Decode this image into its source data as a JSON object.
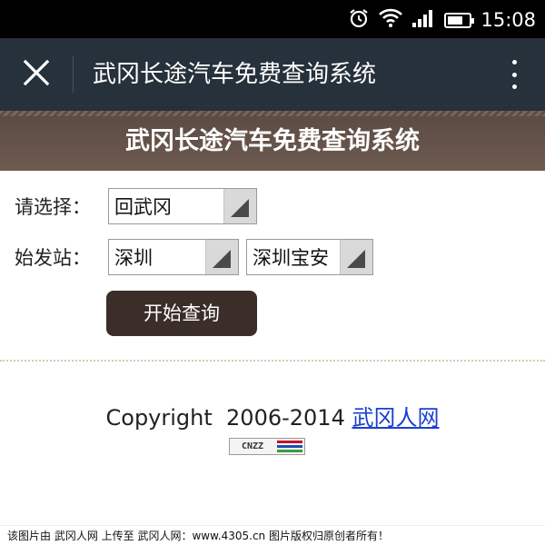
{
  "status_bar": {
    "time": "15:08",
    "icons": [
      "alarm-icon",
      "wifi-icon",
      "signal-icon",
      "battery-icon"
    ],
    "battery_level_pct": 70
  },
  "app_bar": {
    "title": "武冈长途汽车免费查询系统",
    "close_icon": "close-icon",
    "more_icon": "more-vertical-icon"
  },
  "header": {
    "title": "武冈长途汽车免费查询系统"
  },
  "form": {
    "choose_label": "请选择：",
    "choose_value": "回武冈",
    "origin_label": "始发站：",
    "origin_city": "深圳",
    "origin_station": "深圳宝安",
    "submit_label": "开始查询"
  },
  "footer": {
    "copyright_text": "Copyright  2006-2014 ",
    "copyright_link": "武冈人网",
    "badge_text": "CNZZ",
    "badge_colors": [
      "#c8102e",
      "#1e4fb3",
      "#3a9d3a"
    ]
  },
  "watermark": {
    "text": "该图片由 武冈人网 上传至 武冈人网：www.4305.cn 图片版权归原创者所有！"
  },
  "colors": {
    "status_bar": "#000000",
    "app_bar": "#27313b",
    "header": "#5f4d44",
    "button": "#3b2e28",
    "link": "#1a3fd0"
  }
}
